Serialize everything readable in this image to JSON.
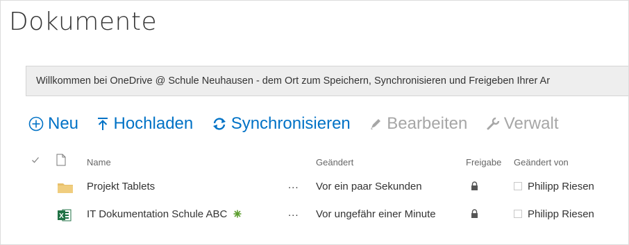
{
  "page": {
    "title": "Dokumente"
  },
  "banner": {
    "text": "Willkommen bei OneDrive @ Schule Neuhausen - dem Ort zum Speichern, Synchronisieren und Freigeben Ihrer Ar"
  },
  "toolbar": {
    "new_label": "Neu",
    "upload_label": "Hochladen",
    "sync_label": "Synchronisieren",
    "edit_label": "Bearbeiten",
    "manage_label": "Verwalt"
  },
  "columns": {
    "name": "Name",
    "modified": "Geändert",
    "sharing": "Freigabe",
    "modified_by": "Geändert von"
  },
  "rows": [
    {
      "type": "folder",
      "name": "Projekt Tablets",
      "new_marker": false,
      "more": "...",
      "modified": "Vor ein paar Sekunden",
      "sharing": "lock-icon",
      "modified_by": "Philipp Riesen"
    },
    {
      "type": "excel",
      "name": "IT Dokumentation Schule ABC",
      "new_marker": true,
      "more": "...",
      "modified": "Vor ungefähr einer Minute",
      "sharing": "lock-icon",
      "modified_by": "Philipp Riesen"
    }
  ],
  "colors": {
    "accent": "#0072c6",
    "disabled": "#a6a6a6",
    "folder": "#e8c06b",
    "excel": "#207245",
    "new_marker": "#5c9e2e"
  }
}
